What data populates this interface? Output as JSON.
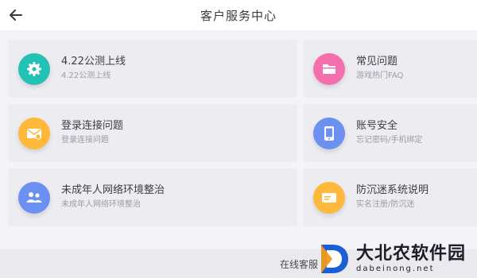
{
  "header": {
    "title": "客户服务中心",
    "back_icon": "arrow-left-icon"
  },
  "items": [
    {
      "title": "4.22公测上线",
      "subtitle": "4.22公测上线",
      "icon": "gear-icon",
      "color": "#22c3b5"
    },
    {
      "title": "常见问题",
      "subtitle": "游戏热门FAQ",
      "icon": "folder-icon",
      "color": "#f56fae"
    },
    {
      "title": "登录连接问题",
      "subtitle": "登录连接问题",
      "icon": "mail-icon",
      "color": "#ffb83a"
    },
    {
      "title": "账号安全",
      "subtitle": "忘记密码/手机绑定",
      "icon": "tablet-icon",
      "color": "#6c8ff2"
    },
    {
      "title": "未成年人网络环境整治",
      "subtitle": "未成年人网络环境整治",
      "icon": "users-icon",
      "color": "#6c8ff2"
    },
    {
      "title": "防沉迷系统说明",
      "subtitle": "实名注册/防沉迷",
      "icon": "id-card-icon",
      "color": "#ffb83a"
    }
  ],
  "footer": {
    "online_service": "在线客服"
  },
  "watermark": {
    "name_cn": "大北农软件园",
    "name_en": "dabeinong.net"
  }
}
